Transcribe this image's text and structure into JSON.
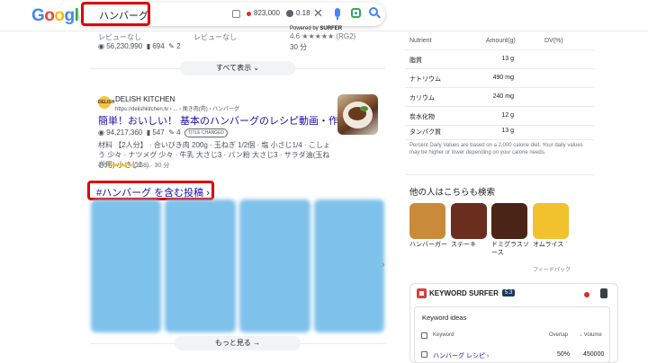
{
  "header": {
    "logo_letters": [
      {
        "ch": "G",
        "color": "#4285F4"
      },
      {
        "ch": "o",
        "color": "#EA4335"
      },
      {
        "ch": "o",
        "color": "#FBBC05"
      },
      {
        "ch": "g",
        "color": "#4285F4"
      },
      {
        "ch": "l",
        "color": "#34A853"
      },
      {
        "ch": "e",
        "color": "#EA4335"
      }
    ],
    "query": "ハンバーグ",
    "stat_volume": "823,000",
    "stat_cpc": "0.18",
    "powered_by": "Powered by",
    "powered_brand": "SURFER"
  },
  "prev_result": {
    "review_col1": "レビューなし",
    "review_col2": "レビューなし",
    "views": "56,230,990",
    "likes": "694",
    "comments": "2",
    "duration": "30 分",
    "rating_stub": "4.6 ★★★★★ (RG2)"
  },
  "show_all": "すべて表示",
  "result": {
    "favicon_text": "DELISH",
    "site_name": "DELISH KITCHEN",
    "site_url": "https://delishkitchen.tv › ... › 挽き肉(肉) › ハンバーグ",
    "title": "簡単！おいしい！ 基本のハンバーグのレシピ動画・作り方",
    "views": "94,217,360",
    "likes": "547",
    "comments": "4",
    "badge": "TITLE CHANGED",
    "snippet": "材料 【2人分】 · 合いびき肉 200g · 玉ねぎ 1/2個 · 塩 小さじ1/4 · こしょう 少々 · ナツメグ 少々 · 牛乳 大さじ3 · パン粉 大さじ3 · サラダ油(玉ねぎ用) 小さじ1 ...",
    "rating": "4.6",
    "review_count": "(958)",
    "duration": "30 分"
  },
  "hashtag_link": "#ハンバーグ を含む投稿 ›",
  "more_button": "もっと見る →",
  "nutrition": {
    "headers": {
      "nutrient": "Nutrient",
      "amount": "Amount(g)",
      "dv": "DV(%)"
    },
    "rows": [
      {
        "name": "脂質",
        "amount": "13 g"
      },
      {
        "name": "ナトリウム",
        "amount": "490 mg"
      },
      {
        "name": "カリウム",
        "amount": "240 mg"
      },
      {
        "name": "炭水化物",
        "amount": "12 g"
      },
      {
        "name": "タンパク質",
        "amount": "13 g"
      }
    ],
    "footnote": "Percent Daily Values are based on a 2,000 calorie diet. Your daily values may be higher or lower depending on your calorie needs."
  },
  "others_search": {
    "title": "他の人はこちらも検索",
    "items": [
      {
        "label": "ハンバーガー",
        "color": "#c98a3a"
      },
      {
        "label": "ステーキ",
        "color": "#6b2e1e"
      },
      {
        "label": "ドミグラスソース",
        "color": "#4a2416"
      },
      {
        "label": "オムライス",
        "color": "#f2c12e"
      }
    ],
    "feedback": "フィードバック"
  },
  "keyword_surfer": {
    "title": "KEYWORD SURFER",
    "version": "5.3",
    "ideas_title": "Keyword ideas",
    "col_keyword": "Keyword",
    "col_overlap": "Overlap",
    "col_volume": "↓ Volume",
    "rows": [
      {
        "keyword": "ハンバーグ レシピ ›",
        "overlap": "50%",
        "volume": "450000"
      }
    ]
  }
}
